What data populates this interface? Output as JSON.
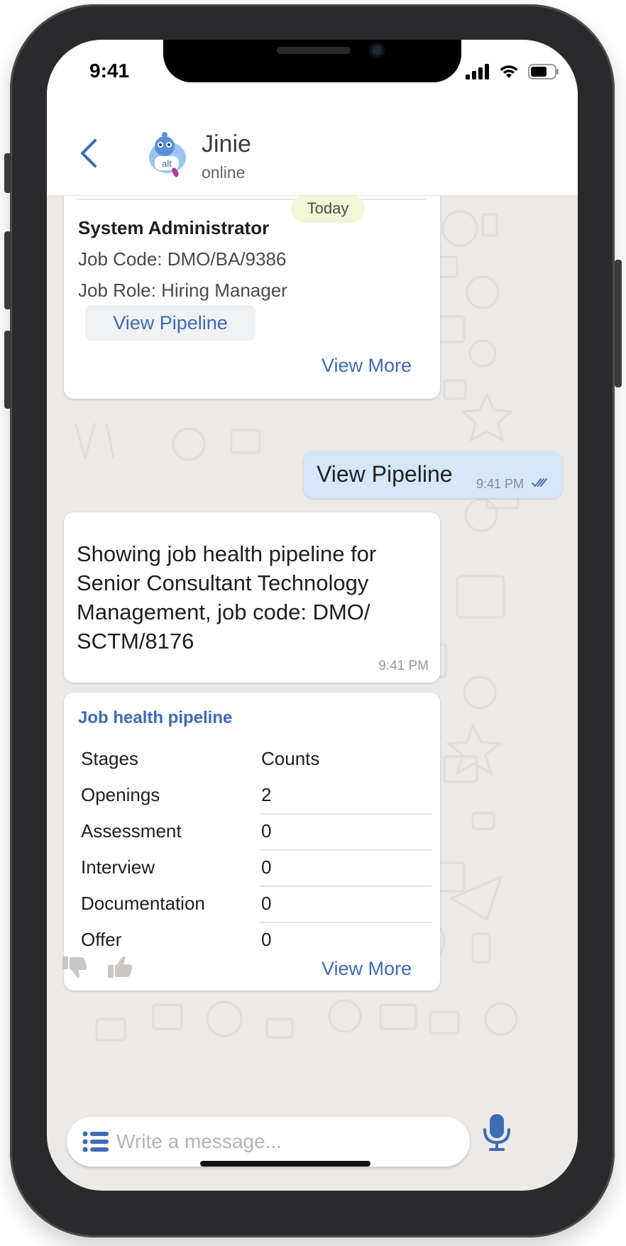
{
  "status_bar": {
    "time": "9:41"
  },
  "header": {
    "name": "Jinie",
    "status": "online",
    "avatar_text": "alt"
  },
  "card_previous": {
    "date_badge": "Today",
    "title": "System Administrator",
    "job_code": "Job Code: DMO/BA/9386",
    "job_role": "Job Role: Hiring Manager",
    "action_label": "View Pipeline",
    "more_label": "View More"
  },
  "outgoing": {
    "text": "View Pipeline",
    "time": "9:41 PM"
  },
  "incoming": {
    "text": "Showing job health pipeline for Senior Consultant Technology Management, job code: DMO/ SCTM/8176",
    "time": "9:41 PM"
  },
  "pipeline": {
    "title": "Job health pipeline",
    "header": {
      "stage": "Stages",
      "count": "Counts"
    },
    "rows": [
      {
        "stage": "Openings",
        "count": "2"
      },
      {
        "stage": "Assessment",
        "count": "0"
      },
      {
        "stage": "Interview",
        "count": "0"
      },
      {
        "stage": "Documentation",
        "count": "0"
      },
      {
        "stage": "Offer",
        "count": "0"
      }
    ],
    "more_label": "View More"
  },
  "composer": {
    "placeholder": "Write a message..."
  },
  "colors": {
    "accent": "#3f6ab4",
    "outgoing_bubble": "#d4e7fb",
    "chat_bg": "#ece9e7",
    "today_badge": "#f3f7d7"
  }
}
